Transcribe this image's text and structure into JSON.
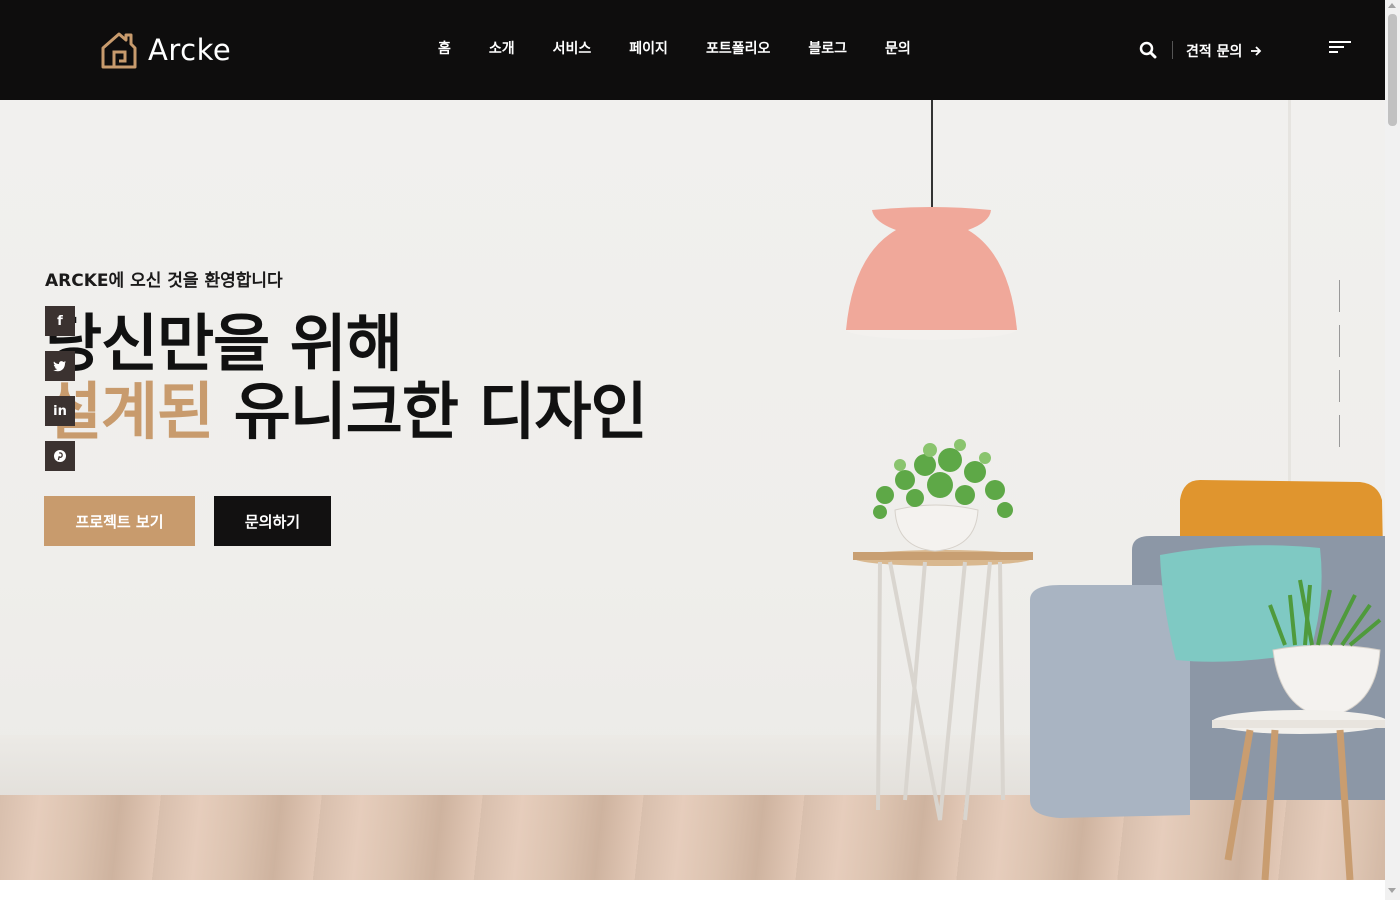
{
  "brand": {
    "name": "Arcke",
    "accent_color": "#c89b6d",
    "dark_color": "#0e0d0d"
  },
  "nav": {
    "items": [
      "홈",
      "소개",
      "서비스",
      "페이지",
      "포트폴리오",
      "블로그",
      "문의"
    ]
  },
  "header": {
    "quote_label": "견적 문의",
    "search_icon": "search-icon",
    "menu_icon": "hamburger-menu-icon"
  },
  "hero": {
    "subtitle": "ARCKE에 오신 것을 환영합니다",
    "title_line1": "당신만을 위해",
    "title_accent": "설계된",
    "title_line2_rest": " 유니크한 디자인",
    "primary_button": "프로젝트 보기",
    "secondary_button": "문의하기"
  },
  "socials": [
    {
      "icon": "facebook-icon",
      "glyph": "f"
    },
    {
      "icon": "twitter-icon",
      "glyph": "t"
    },
    {
      "icon": "linkedin-icon",
      "glyph": "in"
    },
    {
      "icon": "pinterest-icon",
      "glyph": "p"
    }
  ]
}
